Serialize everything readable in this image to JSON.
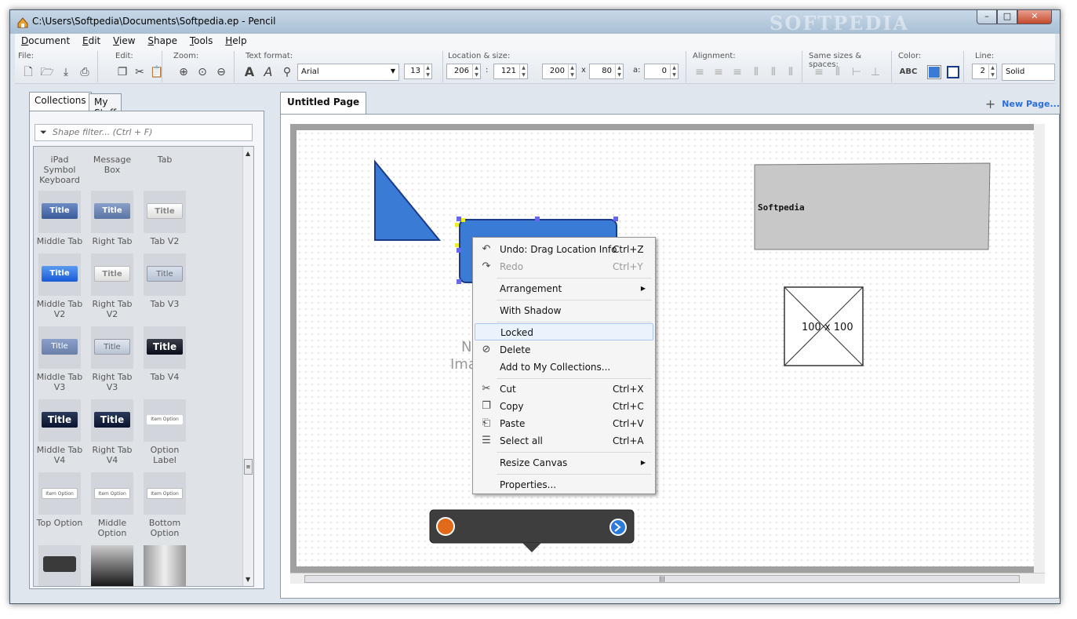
{
  "window": {
    "title": "C:\\Users\\Softpedia\\Documents\\Softpedia.ep - Pencil",
    "watermark": "SOFTPEDIA",
    "controls": {
      "minimize": "–",
      "maximize": "□",
      "close": "✕"
    }
  },
  "menu": [
    "Document",
    "Edit",
    "View",
    "Shape",
    "Tools",
    "Help"
  ],
  "toolbar": {
    "file_label": "File:",
    "edit_label": "Edit:",
    "zoom_label": "Zoom:",
    "text_format_label": "Text format:",
    "font": "Arial",
    "font_size": "13",
    "location_label": "Location & size:",
    "x": "206",
    "y": "121",
    "width": "200",
    "height": "80",
    "angle": "0",
    "sep_colon": ":",
    "sep_x": "x",
    "sep_a": "a:",
    "alignment_label": "Alignment:",
    "same_sizes_label": "Same sizes & spaces:",
    "color_label": "Color:",
    "color_abc": "ABC",
    "line_label": "Line:",
    "line_width": "2",
    "line_style": "Solid",
    "colors": {
      "fill": "#3a7bd5",
      "stroke": "#1a3a8a"
    }
  },
  "left_panel": {
    "tabs": [
      "Collections",
      "My Stuff"
    ],
    "filter_placeholder": "Shape filter... (Ctrl + F)",
    "shapes": [
      {
        "name": "iPad Symbol Keyboard"
      },
      {
        "name": "Message Box"
      },
      {
        "name": "Tab"
      },
      {
        "name": "Middle Tab",
        "thumb": "Title"
      },
      {
        "name": "Right Tab",
        "thumb": "Title"
      },
      {
        "name": "Tab V2",
        "thumb": "Title"
      },
      {
        "name": "Middle Tab V2",
        "thumb": "Title"
      },
      {
        "name": "Right Tab V2",
        "thumb": "Title"
      },
      {
        "name": "Tab V3",
        "thumb": "Title"
      },
      {
        "name": "Middle Tab V3",
        "thumb": "Title"
      },
      {
        "name": "Right Tab V3",
        "thumb": "Title"
      },
      {
        "name": "Tab V4",
        "thumb": "Title"
      },
      {
        "name": "Middle Tab V4",
        "thumb": "Title"
      },
      {
        "name": "Right Tab V4",
        "thumb": "Title"
      },
      {
        "name": "Option Label",
        "thumb": "Item Option"
      },
      {
        "name": "Top Option",
        "thumb": "Item Option"
      },
      {
        "name": "Middle Option",
        "thumb": "Item Option"
      },
      {
        "name": "Bottom Option",
        "thumb": "Item Option"
      }
    ]
  },
  "right_panel": {
    "page_tab": "Untitled Page",
    "new_page": "New Page...",
    "canvas": {
      "label_softpedia": "Softpedia",
      "placeholder_size": "100 x 100",
      "no_image_1": "No",
      "no_image_2": "Imag"
    }
  },
  "context_menu": {
    "items": [
      {
        "label": "Undo: Drag Location Info",
        "shortcut": "Ctrl+Z",
        "icon": "undo-icon"
      },
      {
        "label": "Redo",
        "shortcut": "Ctrl+Y",
        "icon": "redo-icon",
        "disabled": true
      },
      {
        "label": "Arrangement",
        "submenu": true
      },
      {
        "label": "With Shadow"
      },
      {
        "label": "Locked",
        "highlighted": true
      },
      {
        "label": "Delete",
        "icon": "delete-icon"
      },
      {
        "label": "Add to My Collections..."
      },
      {
        "label": "Cut",
        "shortcut": "Ctrl+X",
        "icon": "cut-icon"
      },
      {
        "label": "Copy",
        "shortcut": "Ctrl+C",
        "icon": "copy-icon"
      },
      {
        "label": "Paste",
        "shortcut": "Ctrl+V",
        "icon": "paste-icon"
      },
      {
        "label": "Select all",
        "shortcut": "Ctrl+A",
        "icon": "select-all-icon"
      },
      {
        "label": "Resize Canvas",
        "submenu": true
      },
      {
        "label": "Properties..."
      }
    ]
  }
}
